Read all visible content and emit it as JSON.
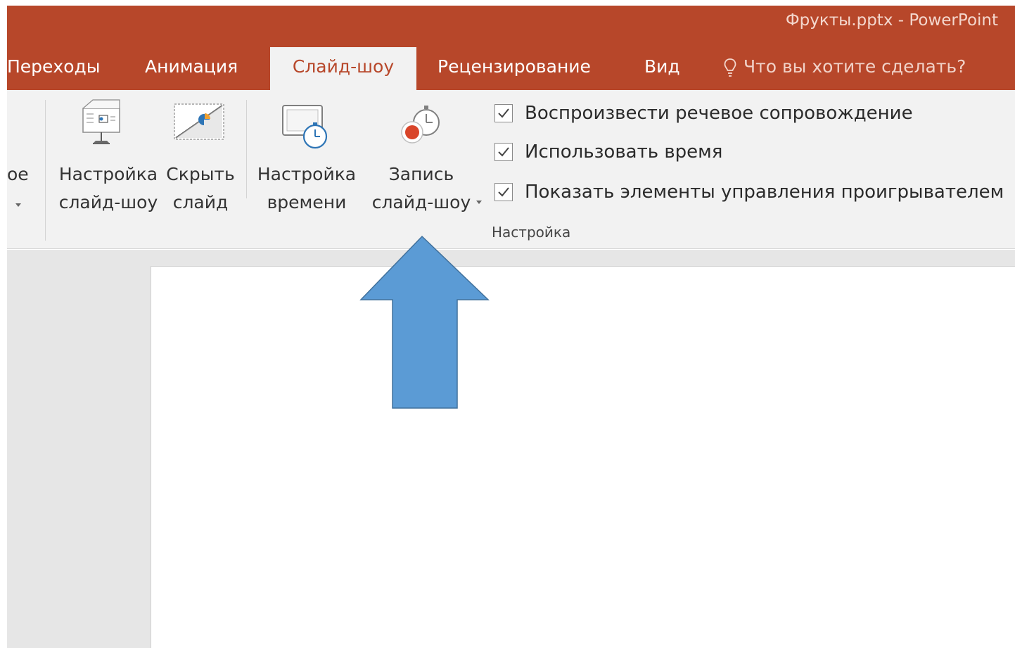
{
  "titlebar": {
    "title": "Фрукты.pptx - PowerPoint",
    "color": "#b7472a"
  },
  "tabs": [
    {
      "label": "Переходы"
    },
    {
      "label": "Анимация"
    },
    {
      "label": "Слайд-шоу",
      "active": true
    },
    {
      "label": "Рецензирование"
    },
    {
      "label": "Вид"
    }
  ],
  "tell_me": {
    "icon": "lightbulb-icon",
    "placeholder": "Что вы хотите сделать?"
  },
  "ribbon": {
    "cut_off_button": {
      "label": "ое"
    },
    "setup_slideshow": {
      "line1": "Настройка",
      "line2": "слайд-шоу",
      "icon": "slideshow-setup-icon"
    },
    "hide_slide": {
      "line1": "Скрыть",
      "line2": "слайд",
      "icon": "hide-slide-icon"
    },
    "rehearse_timings": {
      "line1": "Настройка",
      "line2": "времени",
      "icon": "rehearse-timings-icon"
    },
    "record_slideshow": {
      "line1": "Запись",
      "line2": "слайд-шоу",
      "icon": "record-slideshow-icon"
    },
    "checkboxes": [
      {
        "label": "Воспроизвести речевое сопровождение",
        "checked": true
      },
      {
        "label": "Использовать время",
        "checked": true
      },
      {
        "label": "Показать элементы управления проигрывателем",
        "checked": true
      }
    ],
    "group_label": "Настройка"
  },
  "annotation": {
    "shape": "up-arrow",
    "color": "#5b9bd5",
    "outline": "#41719c"
  }
}
